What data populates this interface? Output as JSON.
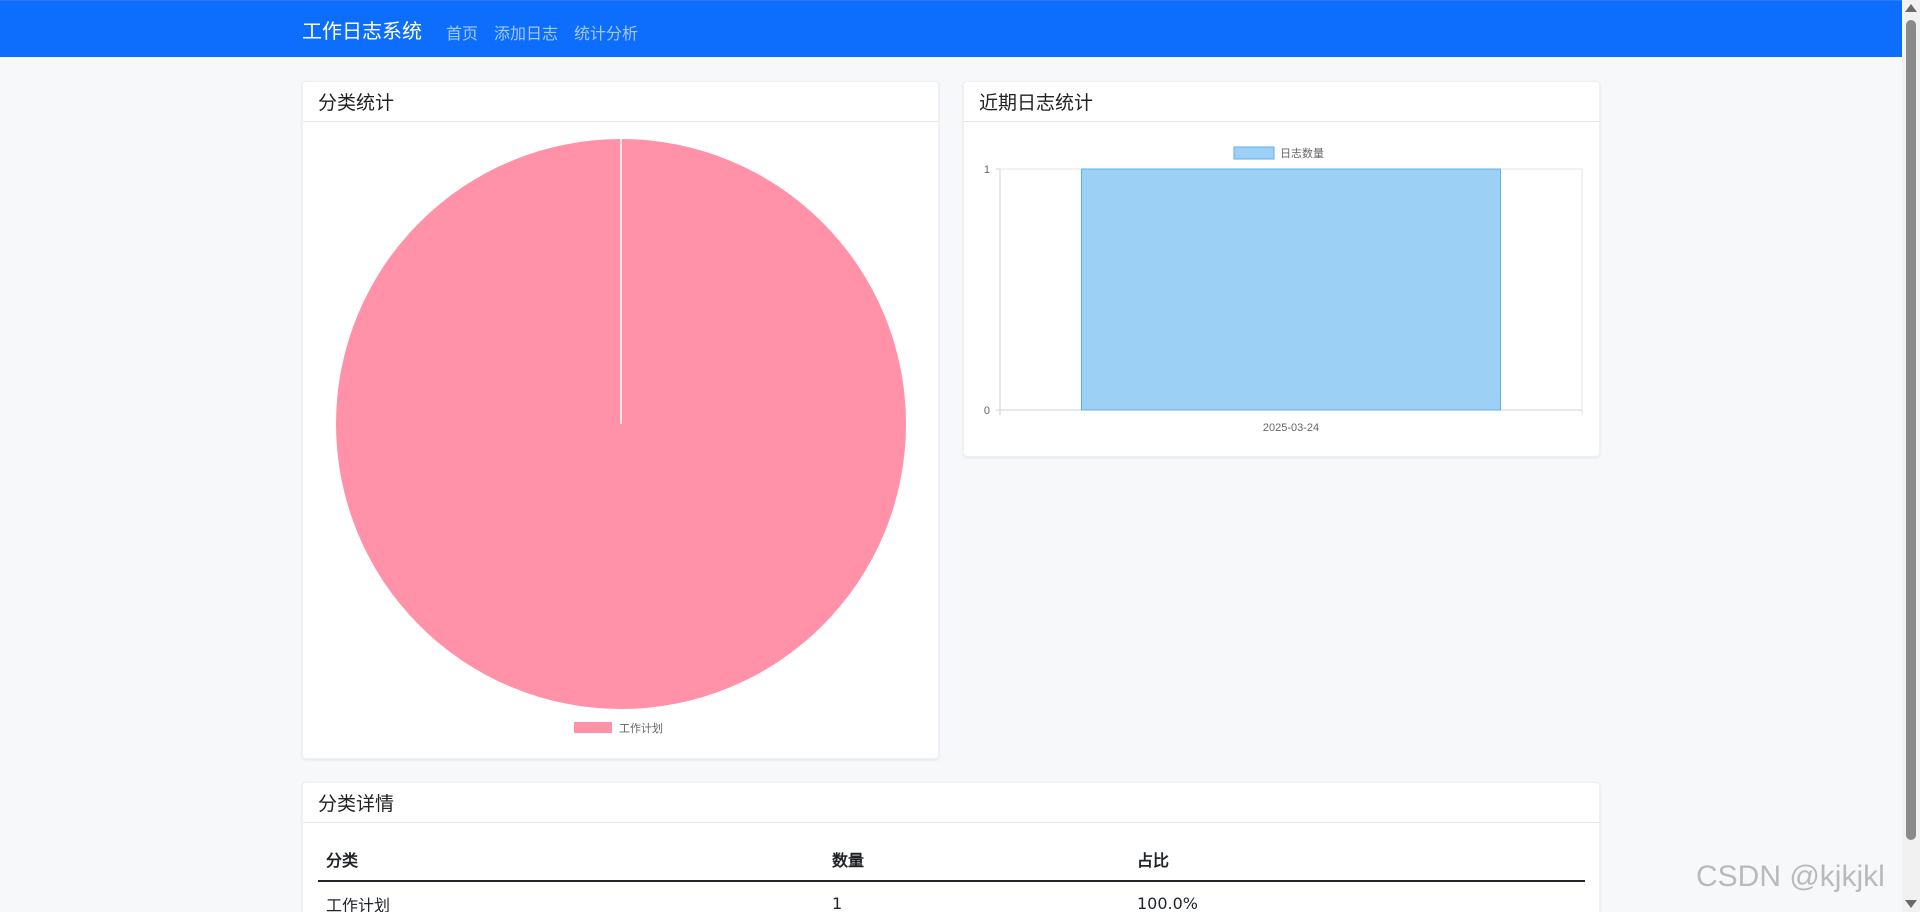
{
  "navbar": {
    "brand": "工作日志系统",
    "links": [
      "首页",
      "添加日志",
      "统计分析"
    ],
    "bg_color": "#0d6efd"
  },
  "category_card": {
    "title": "分类统计"
  },
  "recent_card": {
    "title": "近期日志统计"
  },
  "details_card": {
    "title": "分类详情",
    "columns": [
      "分类",
      "数量",
      "占比"
    ],
    "rows": [
      [
        "工作计划",
        "1",
        "100.0%"
      ]
    ]
  },
  "chart_data": [
    {
      "type": "pie",
      "labels": [
        "工作计划"
      ],
      "values": [
        1
      ],
      "colors": [
        "#ff91a8"
      ],
      "legend": "bottom"
    },
    {
      "type": "bar",
      "categories": [
        "2025-03-24"
      ],
      "series": [
        {
          "name": "日志数量",
          "values": [
            1
          ],
          "color": "#9dd0f5"
        }
      ],
      "ylim": [
        0,
        1
      ],
      "yticks": [
        "0",
        "1"
      ],
      "legend": "top"
    }
  ],
  "watermark": "CSDN @kjkjkl"
}
